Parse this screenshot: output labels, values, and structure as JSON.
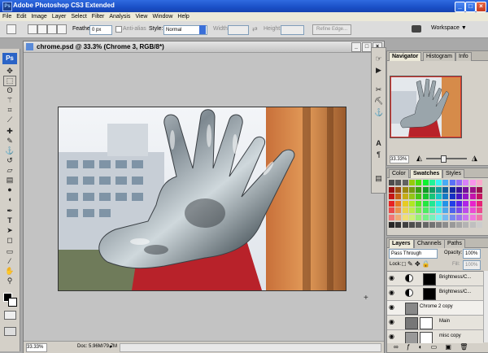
{
  "window": {
    "title": "Adobe Photoshop CS3 Extended",
    "app_icon": "Ps"
  },
  "menu": [
    "File",
    "Edit",
    "Image",
    "Layer",
    "Select",
    "Filter",
    "Analysis",
    "View",
    "Window",
    "Help"
  ],
  "options": {
    "feather_label": "Feather:",
    "feather_value": "0 px",
    "antialias_label": "Anti-alias",
    "style_label": "Style:",
    "style_value": "Normal",
    "width_label": "Width:",
    "height_label": "Height:",
    "refine_label": "Refine Edge...",
    "workspace_label": "Workspace ▼"
  },
  "toolbox": {
    "logo": "Ps"
  },
  "document": {
    "title": "chrome.psd @ 33.3% (Chrome 3, RGB/8*)",
    "zoom": "33.33%",
    "doc_info": "Doc: 5.96M/79.7M"
  },
  "navigator": {
    "tabs": [
      "Navigator",
      "Histogram",
      "Info"
    ],
    "zoom": "33.33%"
  },
  "swatches": {
    "tabs": [
      "Color",
      "Swatches",
      "Styles"
    ]
  },
  "layers": {
    "tabs": [
      "Layers",
      "Channels",
      "Paths"
    ],
    "blend_mode": "Pass Through",
    "opacity_label": "Opacity:",
    "opacity_value": "100%",
    "lock_label": "Lock:",
    "fill_label": "Fill:",
    "fill_value": "100%",
    "items": [
      {
        "name": "Brightness/C..."
      },
      {
        "name": "Brightness/C..."
      },
      {
        "name": "Chrome 2 copy"
      },
      {
        "name": "Main"
      },
      {
        "name": "misc copy"
      }
    ]
  },
  "colors": {
    "titlebar": "#1a4fc7",
    "chrome": "#d4d0c8",
    "canvas_bg": "#c3c3c3"
  }
}
